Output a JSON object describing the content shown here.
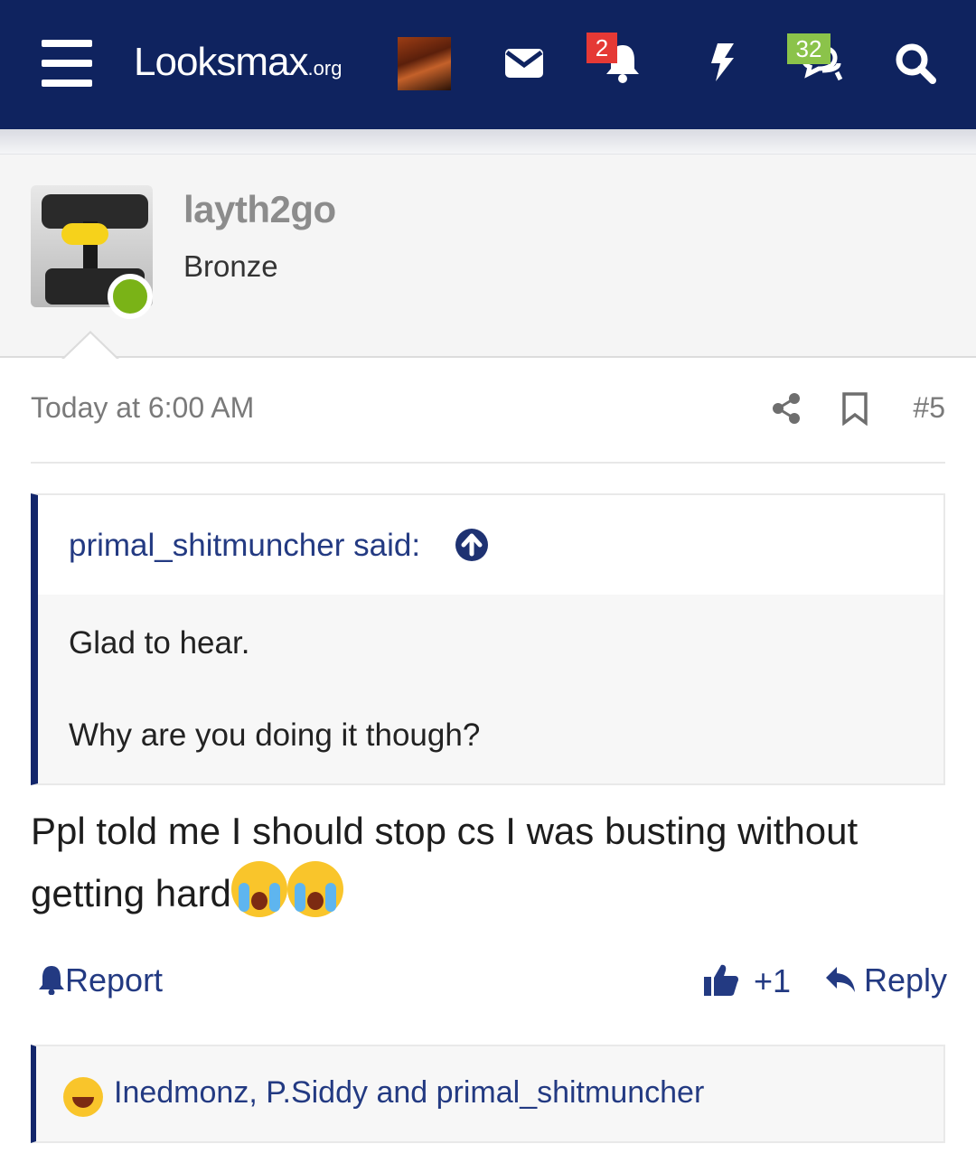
{
  "header": {
    "logo_main": "Looksmax",
    "logo_tld": ".org",
    "alerts_badge": "2",
    "conversations_badge": "32"
  },
  "post": {
    "username": "layth2go",
    "rank": "Bronze",
    "time": "Today at 6:00 AM",
    "number": "#5",
    "quote": {
      "author": "primal_shitmuncher said:",
      "line1": "Glad to hear.",
      "line2": "Why are you doing it though?"
    },
    "body_line1": "Ppl told me I should stop cs I was busting without",
    "body_line2": "getting hard"
  },
  "actions": {
    "report": "Report",
    "like_count": "+1",
    "reply": "Reply"
  },
  "reactions": {
    "names": "Inedmonz, P.Siddy and primal_shitmuncher"
  },
  "colors": {
    "nav_bg": "#0f235f",
    "accent": "#233a82",
    "alert_badge": "#e53935",
    "conv_badge": "#8bc34a",
    "online": "#7ab317"
  }
}
